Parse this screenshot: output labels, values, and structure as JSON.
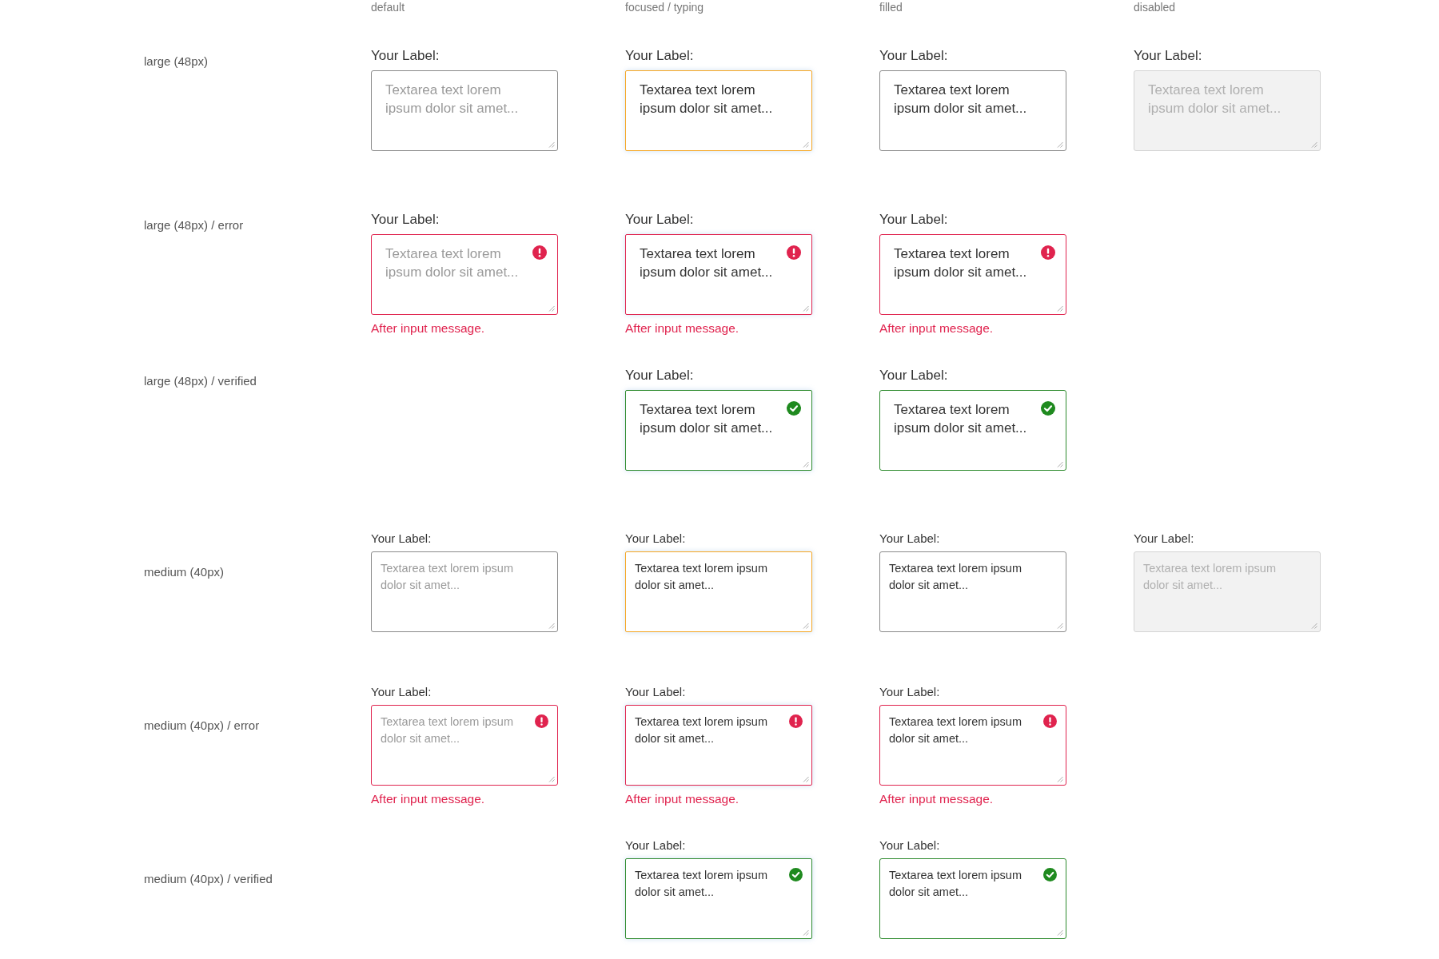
{
  "column_headers": [
    "default",
    "focused / typing",
    "filled",
    "disabled"
  ],
  "rows": [
    {
      "label": "large (48px)",
      "kind": "large",
      "cells": [
        {
          "kind": "default",
          "label": "Your Label:",
          "placeholder": "Textarea text lorem ipsum dolor sit amet..."
        },
        {
          "kind": "focused",
          "label": "Your Label:",
          "value": "Textarea text lorem ipsum dolor sit amet..."
        },
        {
          "kind": "filled",
          "label": "Your Label:",
          "value": "Textarea text lorem ipsum dolor sit amet..."
        },
        {
          "kind": "disabled",
          "label": "Your Label:",
          "placeholder": "Textarea text lorem ipsum dolor sit amet..."
        }
      ]
    },
    {
      "label": "large (48px) / error",
      "kind": "large_err",
      "cells": [
        {
          "kind": "default",
          "label": "Your Label:",
          "placeholder": "Textarea text lorem ipsum dolor sit amet...",
          "message": "After input message."
        },
        {
          "kind": "focused",
          "label": "Your Label:",
          "value": "Textarea text lorem ipsum dolor sit amet...",
          "message": "After input message."
        },
        {
          "kind": "filled",
          "label": "Your Label:",
          "value": "Textarea text lorem ipsum dolor sit amet...",
          "message": "After input message."
        }
      ]
    },
    {
      "label": "large (48px) / verified",
      "kind": "large_ok",
      "cells": [
        {
          "kind": "focused",
          "label": "Your Label:",
          "value": "Textarea text lorem ipsum dolor sit amet..."
        },
        {
          "kind": "filled",
          "label": "Your Label:",
          "value": "Textarea text lorem ipsum dolor sit amet..."
        }
      ]
    },
    {
      "label": "medium (40px)",
      "kind": "medium",
      "cells": [
        {
          "kind": "default",
          "label": "Your Label:",
          "placeholder": "Textarea text lorem ipsum dolor sit amet..."
        },
        {
          "kind": "focused",
          "label": "Your Label:",
          "value": "Textarea text lorem ipsum dolor sit amet..."
        },
        {
          "kind": "filled",
          "label": "Your Label:",
          "value": "Textarea text lorem ipsum dolor sit amet..."
        },
        {
          "kind": "disabled",
          "label": "Your Label:",
          "placeholder": "Textarea text lorem ipsum dolor sit amet..."
        }
      ]
    },
    {
      "label": "medium (40px) / error",
      "kind": "medium_err",
      "cells": [
        {
          "kind": "default",
          "label": "Your Label:",
          "placeholder": "Textarea text lorem ipsum dolor sit amet...",
          "message": "After input message."
        },
        {
          "kind": "focused",
          "label": "Your Label:",
          "value": "Textarea text lorem ipsum dolor sit amet...",
          "message": "After input message."
        },
        {
          "kind": "filled",
          "label": "Your Label:",
          "value": "Textarea text lorem ipsum dolor sit amet...",
          "message": "After input message."
        }
      ]
    },
    {
      "label": "medium (40px) / verified",
      "kind": "medium_ok",
      "cells": [
        {
          "kind": "focused",
          "label": "Your Label:",
          "value": "Textarea text lorem ipsum dolor sit amet..."
        },
        {
          "kind": "filled",
          "label": "Your Label:",
          "value": "Textarea text lorem ipsum dolor sit amet..."
        }
      ]
    }
  ]
}
